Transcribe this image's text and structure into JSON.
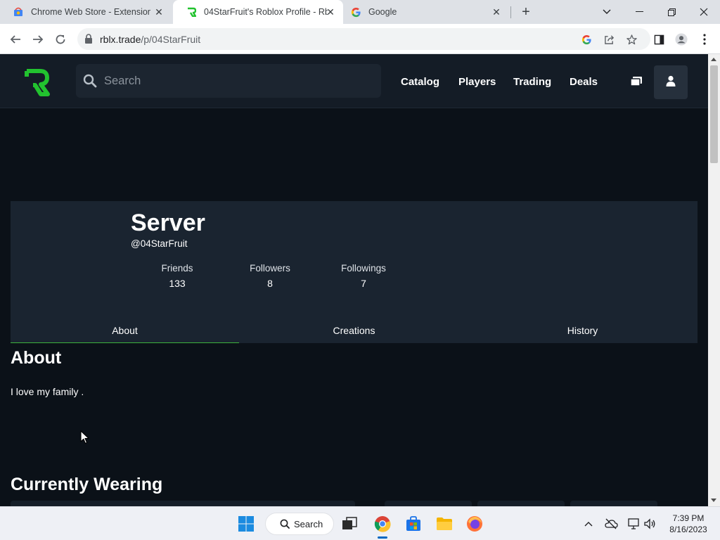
{
  "browser": {
    "tabs": [
      {
        "title": "Chrome Web Store - Extensions",
        "icon": "chrome-web-store-icon",
        "active": false
      },
      {
        "title": "04StarFruit's Roblox Profile - Rblx",
        "icon": "rblx-trade-icon",
        "active": true
      },
      {
        "title": "Google",
        "icon": "google-icon",
        "active": false
      }
    ],
    "url_host": "rblx.trade",
    "url_path": "/p/04StarFruit"
  },
  "site": {
    "search_placeholder": "Search",
    "nav": [
      "Catalog",
      "Players",
      "Trading",
      "Deals"
    ],
    "brand_color": "#22c22f"
  },
  "profile": {
    "display_name": "Server",
    "username": "@04StarFruit",
    "stats": [
      {
        "label": "Friends",
        "value": "133"
      },
      {
        "label": "Followers",
        "value": "8"
      },
      {
        "label": "Followings",
        "value": "7"
      }
    ],
    "tabs": [
      "About",
      "Creations",
      "History"
    ],
    "active_tab": "About"
  },
  "about": {
    "title": "About",
    "text": "I love my family ."
  },
  "wearing": {
    "title": "Currently Wearing"
  },
  "taskbar": {
    "search_label": "Search",
    "time": "7:39 PM",
    "date": "8/16/2023"
  }
}
